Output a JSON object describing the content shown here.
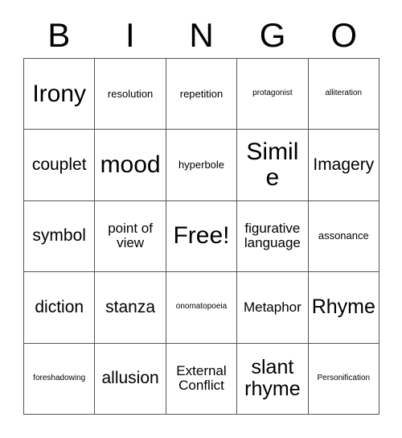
{
  "header": {
    "letters": [
      "B",
      "I",
      "N",
      "G",
      "O"
    ]
  },
  "grid": {
    "rows": [
      [
        {
          "label": "Irony",
          "size": "xxl"
        },
        {
          "label": "resolution",
          "size": "s"
        },
        {
          "label": "repetition",
          "size": "s"
        },
        {
          "label": "protagonist",
          "size": "xs"
        },
        {
          "label": "alliteration",
          "size": "xs"
        }
      ],
      [
        {
          "label": "couplet",
          "size": "l"
        },
        {
          "label": "mood",
          "size": "xxl"
        },
        {
          "label": "hyperbole",
          "size": "s"
        },
        {
          "label": "Simile",
          "size": "xxl"
        },
        {
          "label": "Imagery",
          "size": "l"
        }
      ],
      [
        {
          "label": "symbol",
          "size": "l"
        },
        {
          "label": "point of view",
          "size": "m"
        },
        {
          "label": "Free!",
          "size": "xxl"
        },
        {
          "label": "figurative language",
          "size": "m"
        },
        {
          "label": "assonance",
          "size": "s"
        }
      ],
      [
        {
          "label": "diction",
          "size": "l"
        },
        {
          "label": "stanza",
          "size": "l"
        },
        {
          "label": "onomatopoeia",
          "size": "xs"
        },
        {
          "label": "Metaphor",
          "size": "m"
        },
        {
          "label": "Rhyme",
          "size": "xl"
        }
      ],
      [
        {
          "label": "foreshadowing",
          "size": "xs"
        },
        {
          "label": "allusion",
          "size": "l"
        },
        {
          "label": "External Conflict",
          "size": "m"
        },
        {
          "label": "slant rhyme",
          "size": "xl"
        },
        {
          "label": "Personification",
          "size": "xs"
        }
      ]
    ]
  }
}
